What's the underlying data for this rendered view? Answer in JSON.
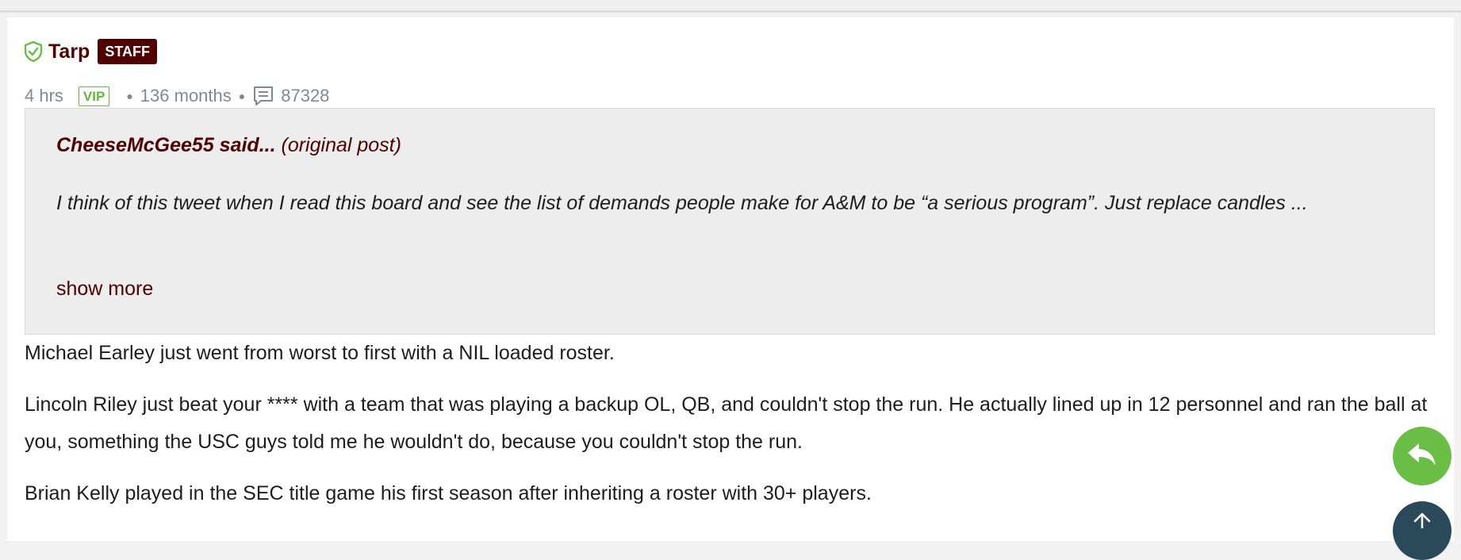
{
  "post": {
    "author": "Tarp",
    "role_badge": "STAFF",
    "time_ago": "4 hrs",
    "vip_badge": "VIP",
    "tenure": "136 months",
    "post_count": "87328"
  },
  "quote": {
    "author_said": "CheeseMcGee55 said...",
    "original_post_label": "(original post)",
    "text": "I think of this tweet when I read this board and see the list of demands people make for A&M to be “a serious program”. Just replace candles ...",
    "show_more": "show more"
  },
  "body": {
    "paragraphs": [
      "Michael Earley just went from worst to first with a NIL loaded roster.",
      "Lincoln Riley just beat your **** with a team that was playing a backup OL, QB, and couldn't stop the run. He actually lined up in 12 personnel and ran the ball at you, something the USC guys told me he wouldn't do, because you couldn't stop the run.",
      "Brian Kelly played in the SEC title game his first season after inheriting a roster with 30+ players."
    ]
  },
  "colors": {
    "maroon": "#500000",
    "vip_green": "#63b83f",
    "reply_button": "#6abd45",
    "scroll_top_button": "#2a4a5c"
  },
  "icons": {
    "verified": "shield-check-icon",
    "posts": "comment-icon",
    "reply": "reply-arrow-icon",
    "scroll_top": "arrow-up-icon"
  }
}
